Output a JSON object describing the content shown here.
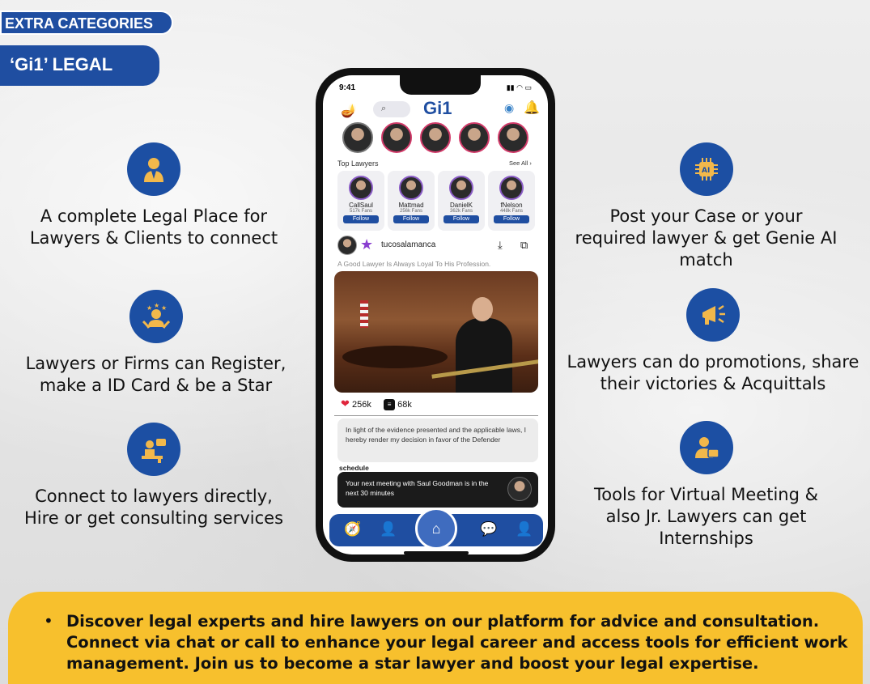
{
  "tags": {
    "extra": "EXTRA CATEGORIES",
    "legal": "‘Gi1’ LEGAL"
  },
  "features_left": [
    {
      "icon": "lawyer-icon",
      "text": "A complete Legal Place for Lawyers & Clients to connect"
    },
    {
      "icon": "star-person-icon",
      "text": "Lawyers or Firms can Register, make a ID Card & be a Star"
    },
    {
      "icon": "consulting-desk-icon",
      "text": "Connect to lawyers directly, Hire or get consulting services"
    }
  ],
  "features_right": [
    {
      "icon": "ai-chip-icon",
      "text": "Post your Case or your required lawyer & get Genie AI match"
    },
    {
      "icon": "megaphone-icon",
      "text": "Lawyers can do promotions, share their victories & Acquittals"
    },
    {
      "icon": "virtual-meeting-icon",
      "text": "Tools for Virtual Meeting & also Jr. Lawyers can get Internships"
    }
  ],
  "phone": {
    "time": "9:41",
    "app_title": "Gi1",
    "top_lawyers_label": "Top Lawyers",
    "see_all": "See All ›",
    "lawyers": [
      {
        "name": "CallSaul",
        "fans": "517k Fans",
        "button": "Follow"
      },
      {
        "name": "Mattmad",
        "fans": "256k Fans",
        "button": "Follow"
      },
      {
        "name": "DanielK",
        "fans": "362k Fans",
        "button": "Follow"
      },
      {
        "name": "fNelson",
        "fans": "448k Fans",
        "button": "Follow"
      }
    ],
    "post": {
      "username": "tucosalamanca",
      "caption": "A Good Lawyer Is Always Loyal To His Profession.",
      "likes": "256k",
      "comments": "68k"
    },
    "quote": "In light of the evidence presented and the applicable laws, I hereby render my decision in favor of the Defender",
    "schedule_label": "schedule",
    "schedule_text": "Your next meeting with Saul Goodman is in the next 30 minutes"
  },
  "footer": {
    "text": "Discover legal experts and hire lawyers on our platform for advice and consultation. Connect via chat or call to enhance your legal career and access tools for efficient work management. Join us to become a star lawyer and boost your legal expertise."
  },
  "colors": {
    "brand_blue": "#1f4ea1",
    "accent_yellow": "#f7c02d"
  }
}
